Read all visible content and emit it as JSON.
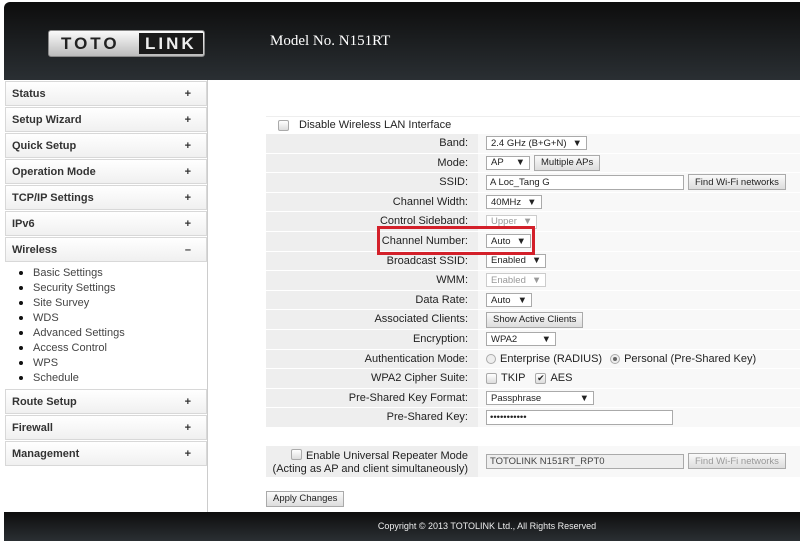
{
  "header": {
    "logo": "TOTO LINK",
    "logo_left": "TOTO",
    "logo_right": "LINK",
    "model": "Model No. N151RT"
  },
  "sidebar": {
    "items": [
      {
        "label": "Status",
        "sign": "+"
      },
      {
        "label": "Setup Wizard",
        "sign": "+"
      },
      {
        "label": "Quick Setup",
        "sign": "+"
      },
      {
        "label": "Operation Mode",
        "sign": "+"
      },
      {
        "label": "TCP/IP Settings",
        "sign": "+"
      },
      {
        "label": "IPv6",
        "sign": "+"
      },
      {
        "label": "Wireless",
        "sign": "–"
      },
      {
        "label": "Route Setup",
        "sign": "+"
      },
      {
        "label": "Firewall",
        "sign": "+"
      },
      {
        "label": "Management",
        "sign": "+"
      }
    ],
    "wireless_sub": [
      "Basic Settings",
      "Security Settings",
      "Site Survey",
      "WDS",
      "Advanced Settings",
      "Access Control",
      "WPS",
      "Schedule"
    ]
  },
  "form": {
    "disable_label": "Disable Wireless LAN Interface",
    "disable_checked": false,
    "band": {
      "label": "Band:",
      "value": "2.4 GHz (B+G+N)"
    },
    "mode": {
      "label": "Mode:",
      "value": "AP",
      "button": "Multiple APs"
    },
    "ssid": {
      "label": "SSID:",
      "value": "A Loc_Tang G",
      "button": "Find Wi-Fi networks"
    },
    "width": {
      "label": "Channel Width:",
      "value": "40MHz"
    },
    "sideband": {
      "label": "Control Sideband:",
      "value": "Upper"
    },
    "channel": {
      "label": "Channel Number:",
      "value": "Auto"
    },
    "broadcast": {
      "label": "Broadcast SSID:",
      "value": "Enabled"
    },
    "wmm": {
      "label": "WMM:",
      "value": "Enabled"
    },
    "rate": {
      "label": "Data Rate:",
      "value": "Auto"
    },
    "clients": {
      "label": "Associated Clients:",
      "button": "Show Active Clients"
    },
    "encryption": {
      "label": "Encryption:",
      "value": "WPA2"
    },
    "auth": {
      "label": "Authentication Mode:",
      "opt1": "Enterprise (RADIUS)",
      "opt2": "Personal (Pre-Shared Key)",
      "selected": "Personal (Pre-Shared Key)"
    },
    "cipher": {
      "label": "WPA2 Cipher Suite:",
      "tkip": "TKIP",
      "aes": "AES",
      "tkip_checked": false,
      "aes_checked": true
    },
    "pskformat": {
      "label": "Pre-Shared Key Format:",
      "value": "Passphrase"
    },
    "psk": {
      "label": "Pre-Shared Key:",
      "value": "•••••••••••"
    },
    "repeater": {
      "label": "Enable Universal Repeater Mode",
      "sub": "(Acting as AP and client simultaneously)",
      "value": "TOTOLINK N151RT_RPT0",
      "button": "Find Wi-Fi networks",
      "checked": false
    },
    "apply": "Apply Changes",
    "arrow": "▼",
    "check": "✔"
  },
  "footer": {
    "copyright": "Copyright © 2013 TOTOLINK Ltd.,   All Rights Reserved"
  },
  "colors": {
    "highlight": "#d3202a"
  }
}
